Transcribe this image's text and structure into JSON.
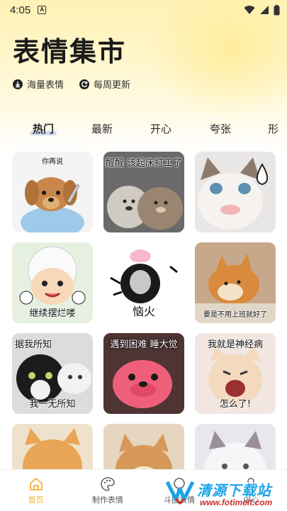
{
  "status_bar": {
    "time": "4:05",
    "notification_glyph": "A",
    "icons": [
      "wifi-icon",
      "signal-icon",
      "battery-icon"
    ]
  },
  "header": {
    "title": "表情集市",
    "features": [
      {
        "icon": "download-icon",
        "label": "海量表情"
      },
      {
        "icon": "refresh-icon",
        "label": "每周更新"
      }
    ]
  },
  "tabs": [
    {
      "label": "热门",
      "active": true
    },
    {
      "label": "最新",
      "active": false
    },
    {
      "label": "开心",
      "active": false
    },
    {
      "label": "夸张",
      "active": false
    },
    {
      "label": "形",
      "active": false
    }
  ],
  "stickers": [
    {
      "caption": "你再说",
      "subject": "toy-dog-with-knife"
    },
    {
      "caption": "醒醒 该起床打工了",
      "subject": "sleeping-bears"
    },
    {
      "caption": "",
      "subject": "cat-sweat-drop"
    },
    {
      "caption": "继续摆烂喽",
      "subject": "cartoon-sheep"
    },
    {
      "caption": "恼火",
      "subject": "angry-face-meme"
    },
    {
      "caption": "要是不用上班就好了",
      "subject": "lying-shiba"
    },
    {
      "caption_top": "据我所知",
      "caption_bottom": "我一无所知",
      "subject": "tuxedo-cat"
    },
    {
      "caption": "遇到困难 睡大觉",
      "subject": "pink-plush"
    },
    {
      "caption_top": "我就是神经病",
      "caption_bottom": "怎么了!",
      "subject": "screaming-cat"
    },
    {
      "caption": "",
      "subject": "orange-cat"
    },
    {
      "caption": "",
      "subject": "shiba-dog"
    },
    {
      "caption": "",
      "subject": "fluffy-cat"
    }
  ],
  "bottom_nav": [
    {
      "label": "首页",
      "icon": "home-icon",
      "active": true
    },
    {
      "label": "制作表情",
      "icon": "palette-icon",
      "active": false
    },
    {
      "label": "斗图表情",
      "icon": "chat-icon",
      "active": false
    },
    {
      "label": "中心",
      "icon": "user-icon",
      "active": false
    }
  ],
  "watermark": {
    "title": "清源下载站",
    "url": "www.fotimeit.com"
  },
  "colors": {
    "accent": "#f2b233",
    "hero_top": "#fff2b5",
    "tab_underline": "#8fa6f0"
  }
}
